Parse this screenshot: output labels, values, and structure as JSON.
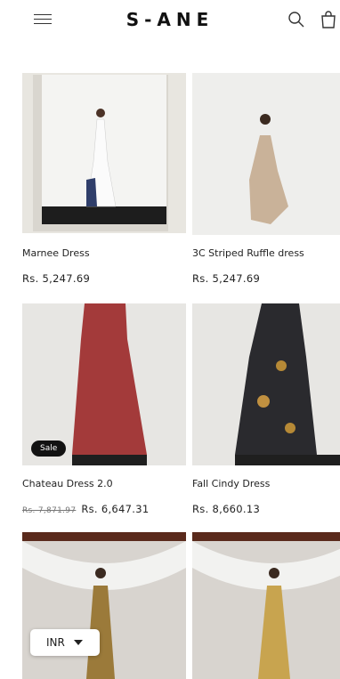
{
  "header": {
    "logo": "S-ANE",
    "icons": {
      "menu": "menu-icon",
      "search": "search-icon",
      "cart": "cart-icon"
    }
  },
  "products": [
    {
      "title": "Marnee Dress",
      "price": "Rs. 5,247.69"
    },
    {
      "title": "3C Striped Ruffle dress",
      "price": "Rs. 5,247.69"
    },
    {
      "title": "Chateau Dress 2.0",
      "old_price": "Rs. 7,871.97",
      "price": "Rs. 6,647.31",
      "badge": "Sale"
    },
    {
      "title": "Fall Cindy Dress",
      "price": "Rs. 8,660.13"
    },
    {
      "title": "",
      "price": ""
    },
    {
      "title": "",
      "price": ""
    }
  ],
  "currency": {
    "selected": "INR"
  },
  "colors": {
    "text": "#1a1a1a",
    "badge_bg": "#121212",
    "sale_dress": "#a33a3a",
    "dark_dress": "#2a2a2e"
  }
}
